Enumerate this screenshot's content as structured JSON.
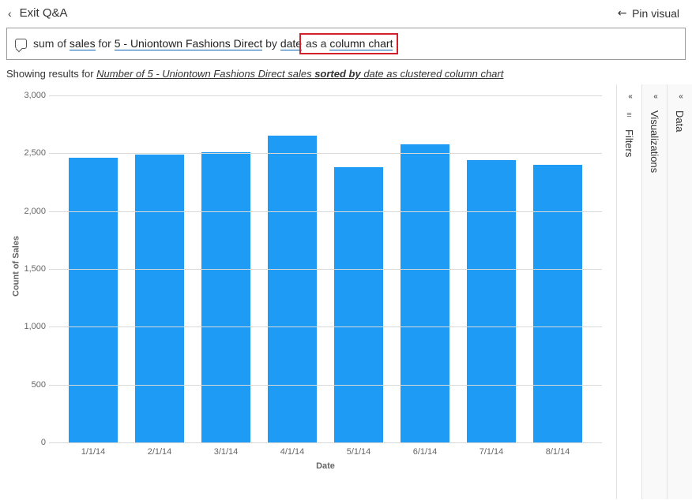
{
  "header": {
    "exit_label": "Exit Q&A",
    "pin_label": "Pin visual"
  },
  "query": {
    "parts": [
      {
        "text": "sum of ",
        "u": false
      },
      {
        "text": "sales",
        "u": true
      },
      {
        "text": " for ",
        "u": false
      },
      {
        "text": "5 - Uniontown Fashions Direct",
        "u": true
      },
      {
        "text": " by ",
        "u": false
      },
      {
        "text": "date",
        "u": true
      }
    ],
    "highlight_parts": [
      {
        "text": " as a ",
        "u": false
      },
      {
        "text": "column chart",
        "u": true
      }
    ]
  },
  "results": {
    "prefix": "Showing results for ",
    "link_before": "Number of 5 - Uniontown Fashions Direct sales ",
    "link_bold": "sorted by",
    "link_after": " date as clustered column chart"
  },
  "chart_data": {
    "type": "bar",
    "title": "",
    "xlabel": "Date",
    "ylabel": "Count of Sales",
    "categories": [
      "1/1/14",
      "2/1/14",
      "3/1/14",
      "4/1/14",
      "5/1/14",
      "6/1/14",
      "7/1/14",
      "8/1/14"
    ],
    "values": [
      2460,
      2490,
      2510,
      2650,
      2380,
      2580,
      2440,
      2400
    ],
    "ylim": [
      0,
      3000
    ],
    "yticks": [
      0,
      500,
      1000,
      1500,
      2000,
      2500,
      3000
    ],
    "ytick_labels": [
      "0",
      "500",
      "1,000",
      "1,500",
      "2,000",
      "2,500",
      "3,000"
    ]
  },
  "panels": {
    "filters": "Filters",
    "visualizations": "Visualizations",
    "data": "Data"
  }
}
